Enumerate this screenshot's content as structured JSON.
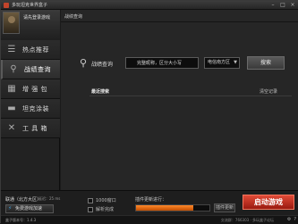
{
  "window": {
    "title": "多玩坦克世界盒子",
    "min_glyph": "–",
    "max_glyph": "□",
    "close_glyph": "×"
  },
  "profile": {
    "login_text": "请先登录游戏"
  },
  "sidebar": {
    "items": [
      {
        "label": "热点推荐",
        "icon": "flame-icon",
        "glyph": "☰"
      },
      {
        "label": "战绩查询",
        "icon": "search-icon",
        "glyph": "⚲"
      },
      {
        "label": "增 强 包",
        "icon": "box-icon",
        "glyph": "▦"
      },
      {
        "label": "坦克涂装",
        "icon": "tank-icon",
        "glyph": "▬"
      },
      {
        "label": "工 具 箱",
        "icon": "tools-icon",
        "glyph": "✕"
      }
    ]
  },
  "main": {
    "tab_label": "战绩查询",
    "search": {
      "label": "战绩查询",
      "input_value": "完整昵称，区分大小写",
      "region": "电信南方区",
      "button_label": "搜索"
    },
    "recent": {
      "label": "最近搜索",
      "clear_label": "清空记录"
    }
  },
  "status": {
    "server": "联通（北方大区）",
    "server_extra": "延迟：25 ms",
    "speed_button": "免费游戏加速",
    "checkbox_window": "1000窗口",
    "checkbox_auto": "解析完成",
    "progress_text": "插件更新进行：",
    "progress": 0.78,
    "progress_button": "插件更新",
    "launch_label": "启动游戏"
  },
  "footer": {
    "version": "盒子版本号：1.4.3",
    "contact": "交流群：766303 · 多玩盒子论坛"
  },
  "colors": {
    "accent": "#e04a36",
    "progress": "#ff8a2a"
  }
}
